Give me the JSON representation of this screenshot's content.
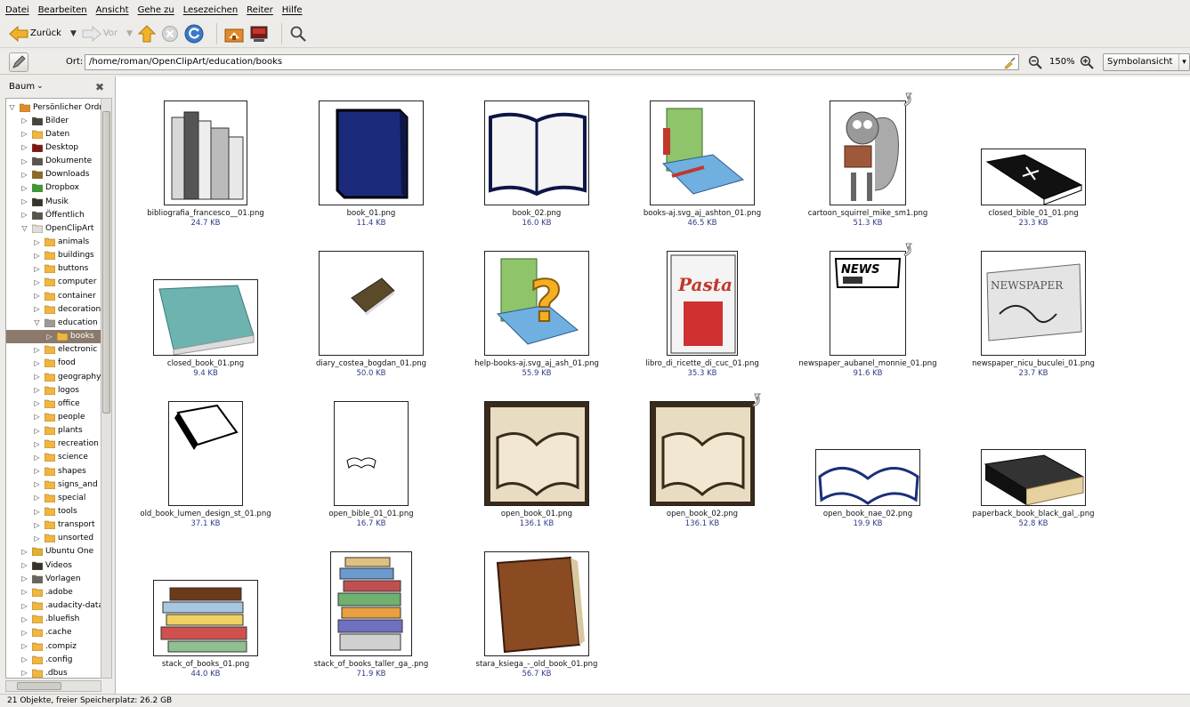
{
  "menu": [
    "Datei",
    "Bearbeiten",
    "Ansicht",
    "Gehe zu",
    "Lesezeichen",
    "Reiter",
    "Hilfe"
  ],
  "toolbar": {
    "back_label": "Zurück",
    "forward_label": "Vor"
  },
  "location": {
    "label": "Ort:",
    "path": "/home/roman/OpenClipArt/education/books",
    "zoom": "150%",
    "view_mode": "Symbolansicht"
  },
  "sidebar": {
    "title": "Baum",
    "items": [
      {
        "label": "Persönlicher Ordner",
        "expanded": true,
        "level": 0,
        "icon": "home"
      },
      {
        "label": "Bilder",
        "level": 1,
        "icon": "pictures"
      },
      {
        "label": "Daten",
        "level": 1,
        "icon": "folder"
      },
      {
        "label": "Desktop",
        "level": 1,
        "icon": "desktop"
      },
      {
        "label": "Dokumente",
        "level": 1,
        "icon": "documents"
      },
      {
        "label": "Downloads",
        "level": 1,
        "icon": "downloads"
      },
      {
        "label": "Dropbox",
        "level": 1,
        "icon": "dropbox"
      },
      {
        "label": "Musik",
        "level": 1,
        "icon": "music"
      },
      {
        "label": "Öffentlich",
        "level": 1,
        "icon": "public"
      },
      {
        "label": "OpenClipArt",
        "expanded": true,
        "level": 1,
        "icon": "openclipart"
      },
      {
        "label": "animals",
        "level": 2,
        "icon": "folder"
      },
      {
        "label": "buildings",
        "level": 2,
        "icon": "folder"
      },
      {
        "label": "buttons",
        "level": 2,
        "icon": "folder"
      },
      {
        "label": "computer",
        "level": 2,
        "icon": "folder"
      },
      {
        "label": "container",
        "level": 2,
        "icon": "folder"
      },
      {
        "label": "decoration",
        "level": 2,
        "icon": "folder"
      },
      {
        "label": "education",
        "expanded": true,
        "level": 2,
        "icon": "folder-open"
      },
      {
        "label": "books",
        "level": 3,
        "icon": "folder",
        "selected": true
      },
      {
        "label": "electronic",
        "level": 2,
        "icon": "folder"
      },
      {
        "label": "food",
        "level": 2,
        "icon": "folder"
      },
      {
        "label": "geography",
        "level": 2,
        "icon": "folder"
      },
      {
        "label": "logos",
        "level": 2,
        "icon": "folder"
      },
      {
        "label": "office",
        "level": 2,
        "icon": "folder"
      },
      {
        "label": "people",
        "level": 2,
        "icon": "folder"
      },
      {
        "label": "plants",
        "level": 2,
        "icon": "folder"
      },
      {
        "label": "recreation",
        "level": 2,
        "icon": "folder"
      },
      {
        "label": "science",
        "level": 2,
        "icon": "folder"
      },
      {
        "label": "shapes",
        "level": 2,
        "icon": "folder"
      },
      {
        "label": "signs_and",
        "level": 2,
        "icon": "folder"
      },
      {
        "label": "special",
        "level": 2,
        "icon": "folder"
      },
      {
        "label": "tools",
        "level": 2,
        "icon": "folder"
      },
      {
        "label": "transport",
        "level": 2,
        "icon": "folder"
      },
      {
        "label": "unsorted",
        "level": 2,
        "icon": "folder"
      },
      {
        "label": "Ubuntu One",
        "level": 1,
        "icon": "ubuntuone"
      },
      {
        "label": "Videos",
        "level": 1,
        "icon": "videos"
      },
      {
        "label": "Vorlagen",
        "level": 1,
        "icon": "templates"
      },
      {
        "label": ".adobe",
        "level": 1,
        "icon": "folder"
      },
      {
        "label": ".audacity-data",
        "level": 1,
        "icon": "folder"
      },
      {
        "label": ".bluefish",
        "level": 1,
        "icon": "folder"
      },
      {
        "label": ".cache",
        "level": 1,
        "icon": "folder"
      },
      {
        "label": ".compiz",
        "level": 1,
        "icon": "folder"
      },
      {
        "label": ".config",
        "level": 1,
        "icon": "folder"
      },
      {
        "label": ".dbus",
        "level": 1,
        "icon": "folder"
      }
    ]
  },
  "files": [
    {
      "name": "bibliografia_francesco__01.png",
      "size": "24.7 KB",
      "art": "book-stack-gray"
    },
    {
      "name": "book_01.png",
      "size": "11.4 KB",
      "art": "blue-book"
    },
    {
      "name": "book_02.png",
      "size": "16.0 KB",
      "art": "open-book-navy"
    },
    {
      "name": "books-aj.svg_aj_ashton_01.png",
      "size": "46.5 KB",
      "art": "green-books"
    },
    {
      "name": "cartoon_squirrel_mike_sm1.png",
      "size": "51.3 KB",
      "art": "squirrel-reading",
      "emblem": true
    },
    {
      "name": "closed_bible_01_01.png",
      "size": "23.3 KB",
      "art": "black-bible"
    },
    {
      "name": "closed_book_01.png",
      "size": "9.4 KB",
      "art": "teal-book"
    },
    {
      "name": "diary_costea_bogdan_01.png",
      "size": "50.0 KB",
      "art": "brown-diary"
    },
    {
      "name": "help-books-aj.svg_aj_ash_01.png",
      "size": "55.9 KB",
      "art": "help-books"
    },
    {
      "name": "libro_di_ricette_di_cuc_01.png",
      "size": "35.3 KB",
      "art": "pasta-book"
    },
    {
      "name": "newspaper_aubanel_monnie_01.png",
      "size": "91.6 KB",
      "art": "news-paper",
      "emblem": true
    },
    {
      "name": "newspaper_nicu_buculei_01.png",
      "size": "23.7 KB",
      "art": "newspaper-gray"
    },
    {
      "name": "old_book_lumen_design_st_01.png",
      "size": "37.1 KB",
      "art": "old-book-bw"
    },
    {
      "name": "open_bible_01_01.png",
      "size": "16.7 KB",
      "art": "small-open-bible"
    },
    {
      "name": "open_book_01.png",
      "size": "136.1 KB",
      "art": "sepia-book"
    },
    {
      "name": "open_book_02.png",
      "size": "136.1 KB",
      "art": "sepia-book",
      "emblem": true
    },
    {
      "name": "open_book_nae_02.png",
      "size": "19.9 KB",
      "art": "blue-open-book"
    },
    {
      "name": "paperback_book_black_gal_.png",
      "size": "52.8 KB",
      "art": "black-paperback"
    },
    {
      "name": "stack_of_books_01.png",
      "size": "44.0 KB",
      "art": "stack-books"
    },
    {
      "name": "stack_of_books_taller_ga_.png",
      "size": "71.9 KB",
      "art": "tall-stack"
    },
    {
      "name": "stara_ksiega_-_old_book_01.png",
      "size": "56.7 KB",
      "art": "leather-book"
    }
  ],
  "status": "21 Objekte, freier Speicherplatz: 26.2 GB"
}
